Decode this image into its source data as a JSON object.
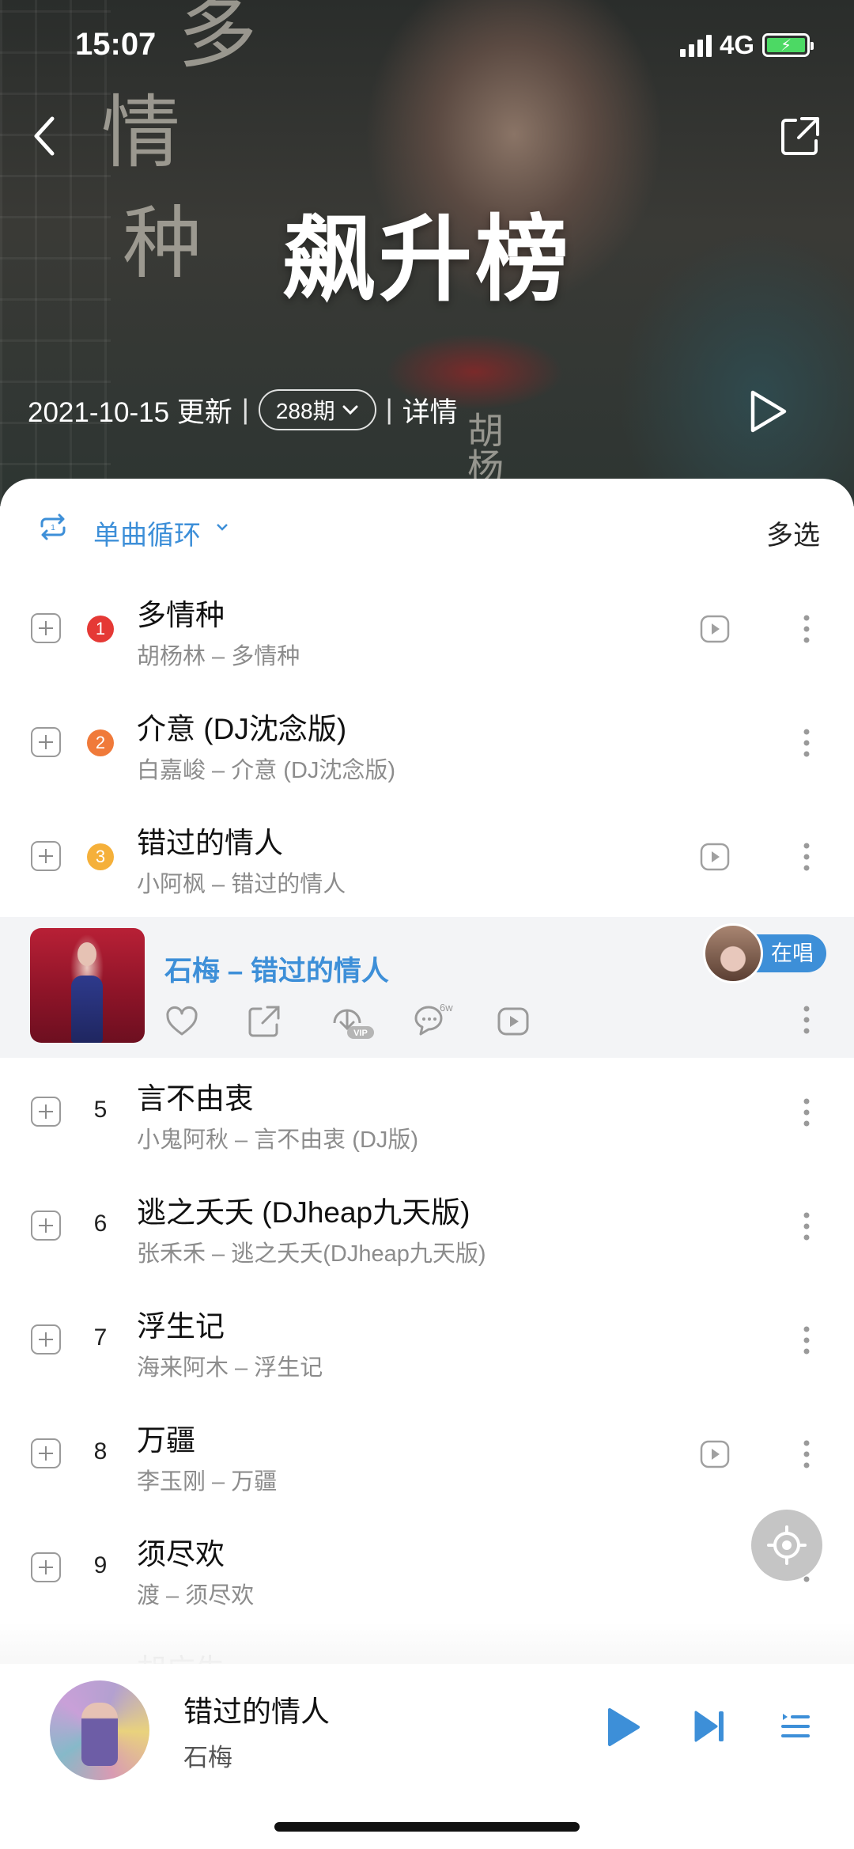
{
  "status_bar": {
    "time": "15:07",
    "network": "4G"
  },
  "header": {
    "art_text": "多情种",
    "art_signature": "胡杨",
    "title": "飙升榜",
    "updated": "2021-10-15 更新",
    "issue": "288期",
    "details": "详情"
  },
  "toolbar": {
    "loop_mode": "单曲循环",
    "multi_select": "多选"
  },
  "songs": [
    {
      "rank": "1",
      "title": "多情种",
      "subtitle": "胡杨林 – 多情种",
      "badge_color": "#e53935",
      "has_mv": true
    },
    {
      "rank": "2",
      "title": "介意 (DJ沈念版)",
      "subtitle": "白嘉峻 – 介意 (DJ沈念版)",
      "badge_color": "#f07a3a",
      "has_mv": false
    },
    {
      "rank": "3",
      "title": "错过的情人",
      "subtitle": "小阿枫 – 错过的情人",
      "badge_color": "#f5b03a",
      "has_mv": true
    },
    {
      "rank": "5",
      "title": "言不由衷",
      "subtitle": "小鬼阿秋 – 言不由衷 (DJ版)",
      "has_mv": false
    },
    {
      "rank": "6",
      "title": "逃之夭夭 (DJheap九天版)",
      "subtitle": "张禾禾 – 逃之夭夭(DJheap九天版)",
      "has_mv": false
    },
    {
      "rank": "7",
      "title": "浮生记",
      "subtitle": "海来阿木 – 浮生记",
      "has_mv": false
    },
    {
      "rank": "8",
      "title": "万疆",
      "subtitle": "李玉刚 – 万疆",
      "has_mv": true
    },
    {
      "rank": "9",
      "title": "须尽欢",
      "subtitle": "渡 – 须尽欢",
      "has_mv": false
    },
    {
      "rank": "",
      "title": "胡广生",
      "subtitle": "",
      "has_mv": false
    }
  ],
  "now_playing_row": {
    "title": "石梅 – 错过的情人",
    "comment_count": "6w",
    "vip_label": "VIP",
    "singing_tag": "在唱"
  },
  "mini_player": {
    "title": "错过的情人",
    "artist": "石梅"
  },
  "colors": {
    "accent": "#3d8fd8",
    "rank1": "#e53935",
    "rank2": "#f07a3a",
    "rank3": "#f5b03a"
  }
}
